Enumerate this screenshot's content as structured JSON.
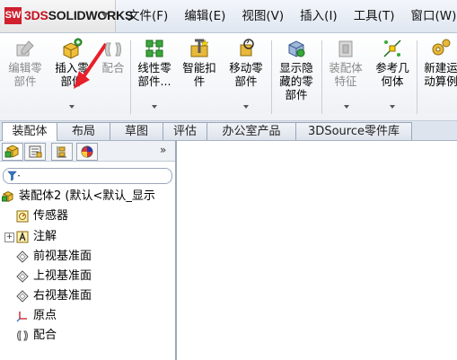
{
  "app": {
    "logo_mark": "SW",
    "logo_ds": "3DS",
    "logo_text": "SOLIDWORKS"
  },
  "menu": [
    "文件(F)",
    "编辑(E)",
    "视图(V)",
    "插入(I)",
    "工具(T)",
    "窗口(W)"
  ],
  "ribbon": {
    "buttons": [
      {
        "id": "edit-component",
        "lines": [
          "编辑零",
          "部件"
        ],
        "enabled": false,
        "icon": "edit-component-icon"
      },
      {
        "id": "insert-components",
        "lines": [
          "插入零",
          "部件"
        ],
        "enabled": true,
        "icon": "insert-components-icon"
      },
      {
        "id": "mate",
        "lines": [
          "配合"
        ],
        "enabled": false,
        "icon": "mate-icon"
      },
      {
        "id": "linear-pattern",
        "lines": [
          "线性零",
          "部件..."
        ],
        "enabled": true,
        "icon": "linear-pattern-icon"
      },
      {
        "id": "smart-fasteners",
        "lines": [
          "智能扣",
          "件"
        ],
        "enabled": true,
        "icon": "smart-fasteners-icon"
      },
      {
        "id": "move-component",
        "lines": [
          "移动零",
          "部件"
        ],
        "enabled": true,
        "icon": "move-component-icon"
      },
      {
        "id": "show-hidden-components",
        "lines": [
          "显示隐",
          "藏的零",
          "部件"
        ],
        "enabled": true,
        "icon": "show-hidden-icon"
      },
      {
        "id": "assembly-features",
        "lines": [
          "装配体",
          "特征"
        ],
        "enabled": false,
        "icon": "assembly-features-icon"
      },
      {
        "id": "reference-geometry",
        "lines": [
          "参考几",
          "何体"
        ],
        "enabled": true,
        "icon": "reference-geometry-icon"
      },
      {
        "id": "new-motion-study",
        "lines": [
          "新建运",
          "动算例"
        ],
        "enabled": true,
        "icon": "motion-study-icon"
      }
    ]
  },
  "tabs": [
    "装配体",
    "布局",
    "草图",
    "评估",
    "办公室产品",
    "3DSource零件库"
  ],
  "active_tab": "装配体",
  "panel": {
    "collapse_glyph": "»",
    "filter_icon": "filter-icon",
    "tabs": [
      "feature-manager-tab",
      "property-manager-tab",
      "configuration-manager-tab",
      "appearance-tab"
    ]
  },
  "tree": {
    "root": "装配体2 (默认<默认_显示",
    "items": [
      {
        "label": "传感器",
        "icon": "sensor-icon",
        "expander": false
      },
      {
        "label": "注解",
        "icon": "annotation-icon",
        "expander": true,
        "expander_glyph": "+"
      },
      {
        "label": "前视基准面",
        "icon": "plane-icon",
        "expander": false
      },
      {
        "label": "上视基准面",
        "icon": "plane-icon",
        "expander": false
      },
      {
        "label": "右视基准面",
        "icon": "plane-icon",
        "expander": false
      },
      {
        "label": "原点",
        "icon": "origin-icon",
        "expander": false
      },
      {
        "label": "配合",
        "icon": "mates-folder-icon",
        "expander": false
      }
    ]
  },
  "colors": {
    "brand_red": "#c2121f",
    "tab_border": "#9aa6b8",
    "disabled_text": "#8a8a8a"
  }
}
